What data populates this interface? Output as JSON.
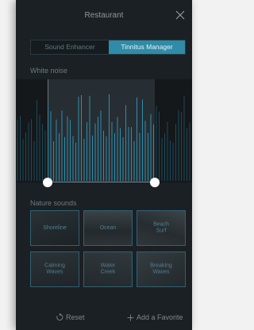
{
  "header": {
    "title": "Restaurant"
  },
  "segments": {
    "options": [
      "Sound Enhancer",
      "Tinnitus Manager"
    ],
    "selected": "Tinnitus Manager"
  },
  "white_noise": {
    "label": "White noise"
  },
  "nature_sounds": {
    "label": "Nature sounds",
    "tiles": [
      {
        "label": "Shoreline"
      },
      {
        "label": "Ocean"
      },
      {
        "label": "Beach\nSurf"
      },
      {
        "label": "Calming\nWaves"
      },
      {
        "label": "Water\nCreek"
      },
      {
        "label": "Breaking\nWaves"
      }
    ]
  },
  "footer": {
    "reset_label": "Reset",
    "add_favorite_label": "Add a Favorite"
  },
  "colors": {
    "accent": "#2f8ba7",
    "background": "#1b2024",
    "tile_border": "#2f6174"
  },
  "icons": {
    "close": "close-icon",
    "reset": "reset-icon",
    "add": "plus-icon"
  }
}
